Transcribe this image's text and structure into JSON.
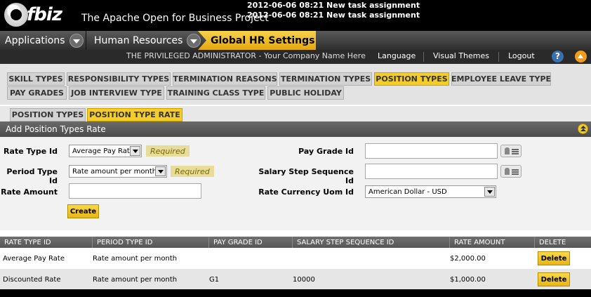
{
  "header": {
    "logo_text": "fbiz",
    "tagline": "The Apache Open for Business Project",
    "notifications": [
      "2012-06-06 08:21 New task assignment",
      "2012-06-06 08:21 New task assignment"
    ]
  },
  "appbar": {
    "applications": "Applications",
    "human_resources": "Human Resources",
    "current": "Global HR Settings"
  },
  "userbar": {
    "user": "THE PRIVILEGED ADMINISTRATOR - Your Company Name Here",
    "language": "Language",
    "visual_themes": "Visual Themes",
    "logout": "Logout",
    "help": "?"
  },
  "subnav": {
    "row1": [
      "SKILL TYPES",
      "RESPONSIBILITY TYPES",
      "TERMINATION REASONS",
      "TERMINATION TYPES",
      "POSITION TYPES",
      "EMPLOYEE LEAVE TYPE"
    ],
    "row2": [
      "PAY GRADES",
      "JOB INTERVIEW TYPE",
      "TRAINING CLASS TYPE",
      "PUBLIC HOLIDAY"
    ],
    "active": "POSITION TYPES"
  },
  "panel_tabs": {
    "position_types": "POSITION TYPES",
    "position_type_rate": "POSITION TYPE RATE",
    "active": "POSITION TYPE RATE"
  },
  "form": {
    "title": "Add Position Types Rate",
    "rate_type_label": "Rate Type Id",
    "rate_type_value": "Average Pay Rate",
    "period_type_label": "Period Type Id",
    "period_type_value": "Rate amount per month",
    "rate_amount_label": "Rate Amount",
    "rate_amount_value": "",
    "required": "Required",
    "pay_grade_label": "Pay Grade Id",
    "pay_grade_value": "",
    "salary_step_label": "Salary Step Sequence Id",
    "salary_step_value": "",
    "currency_label": "Rate Currency Uom Id",
    "currency_value": "American Dollar - USD",
    "create_button": "Create"
  },
  "table": {
    "columns": [
      "RATE TYPE ID",
      "PERIOD TYPE ID",
      "PAY GRADE ID",
      "SALARY STEP SEQUENCE ID",
      "RATE AMOUNT",
      "DELETE"
    ],
    "rows": [
      {
        "rate_type": "Average Pay Rate",
        "period_type": "Rate amount per month",
        "pay_grade": "",
        "salary_step": "",
        "rate_amount": "$2,000.00",
        "delete": "Delete"
      },
      {
        "rate_type": "Discounted Rate",
        "period_type": "Rate amount per month",
        "pay_grade": "G1",
        "salary_step": "10000",
        "rate_amount": "$1,000.00",
        "delete": "Delete"
      }
    ]
  },
  "colors": {
    "accent_yellow": "#f4cd2a",
    "header_bg": "#000000",
    "row_alt": "#e6e6e6"
  }
}
